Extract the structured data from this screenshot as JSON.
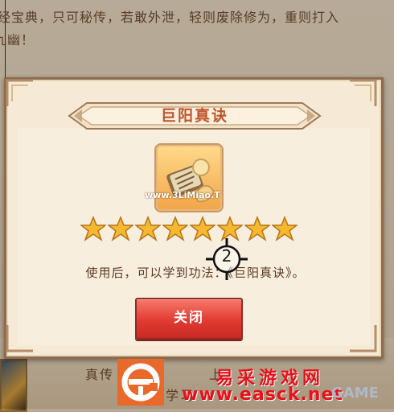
{
  "background": {
    "text_line_1": "真经宝典，只可秘传，若敢外泄，轻则废除修为，重则打入",
    "text_line_2": "九幽！",
    "bottom_line_1": "真传",
    "bottom_line_1b": "上，",
    "bottom_line_2": "学习"
  },
  "dialog": {
    "title": "巨阳真诀",
    "item_overlay_text": "www.3LiMiao.T",
    "stars_count": 8,
    "stars_filled": 8,
    "description": "使用后，可以学到功法：《巨阳真诀》。",
    "close_label": "关闭"
  },
  "cursor": {
    "label": "2"
  },
  "watermark": {
    "site_name": "易采游戏网",
    "site_url": "www.easck.net",
    "faint_text": "GAME"
  },
  "colors": {
    "title": "#c0552e",
    "close_button": "#e23b32",
    "star": "#f5b830",
    "watermark": "#e8101a"
  }
}
